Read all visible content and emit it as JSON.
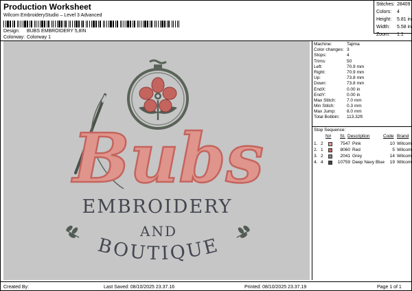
{
  "header": {
    "title": "Production Worksheet",
    "subtitle": "Wilcom EmbroideryStudio – Level 3 Advanced",
    "design_label": "Design:",
    "design_value": "BUBS EMBROIDERY 5,8IN",
    "colorway_label": "Colorway:",
    "colorway_value": "Colorway 1"
  },
  "stats": [
    {
      "label": "Stitches:",
      "value": "28409"
    },
    {
      "label": "Colors:",
      "value": "4"
    },
    {
      "label": "Height:",
      "value": "5.81 in"
    },
    {
      "label": "Width:",
      "value": "5.58 in"
    },
    {
      "label": "Zoom:",
      "value": "1:1"
    }
  ],
  "design": {
    "word_main": "Bubs",
    "word_line1": "EMBROIDERY",
    "word_line2": "AND",
    "word_line3": "BOUTIQUE",
    "colors": {
      "background": "#c6c6c6",
      "pink": "#e0958c",
      "red": "#c4645e",
      "grey": "#525c54",
      "navy": "#444650",
      "hoop": "#5a6358"
    }
  },
  "machine_info": [
    {
      "label": "Machine:",
      "value": "Tajima"
    },
    {
      "label": "Color changes:",
      "value": "3"
    },
    {
      "label": "Stops:",
      "value": "4"
    },
    {
      "label": "Trims:",
      "value": "50"
    },
    {
      "label": "Left:",
      "value": "70.9 mm"
    },
    {
      "label": "Right:",
      "value": "70.9 mm"
    },
    {
      "label": "Up:",
      "value": "73.8 mm"
    },
    {
      "label": "Down:",
      "value": "73.8 mm"
    },
    {
      "label": "EndX:",
      "value": "0.00 in"
    },
    {
      "label": "EndY:",
      "value": "0.00 in"
    },
    {
      "label": "Max Stitch:",
      "value": "7.0 mm"
    },
    {
      "label": "Min Stitch:",
      "value": "0.3 mm"
    },
    {
      "label": "Max Jump:",
      "value": "8.0 mm"
    },
    {
      "label": "Total Bobbin:",
      "value": "113.32ft"
    }
  ],
  "stop_sequence": {
    "title": "Stop Sequence:",
    "columns": {
      "n": "N#",
      "st": "St.",
      "desc": "Description",
      "code": "Code",
      "brand": "Brand"
    },
    "rows": [
      {
        "idx": "1.",
        "n": "2",
        "st": "7547",
        "desc": "Pink",
        "code": "10",
        "brand": "Wilcom",
        "color": "#e0958c"
      },
      {
        "idx": "2.",
        "n": "1",
        "st": "8060",
        "desc": "Red",
        "code": "5",
        "brand": "Wilcom",
        "color": "#c4645e"
      },
      {
        "idx": "3.",
        "n": "2",
        "st": "2041",
        "desc": "Grey",
        "code": "14",
        "brand": "Wilcom",
        "color": "#7d847c"
      },
      {
        "idx": "4.",
        "n": "4",
        "st": "10759",
        "desc": "Deep Navy Blue",
        "code": "19",
        "brand": "Wilcom",
        "color": "#3e4250"
      }
    ]
  },
  "footer": {
    "created_by": "Created By:",
    "last_saved": "Last Saved: 08/10/2025 23.37.16",
    "printed": "Printed: 08/10/2025 23.37.19",
    "page": "Page 1 of 1"
  }
}
